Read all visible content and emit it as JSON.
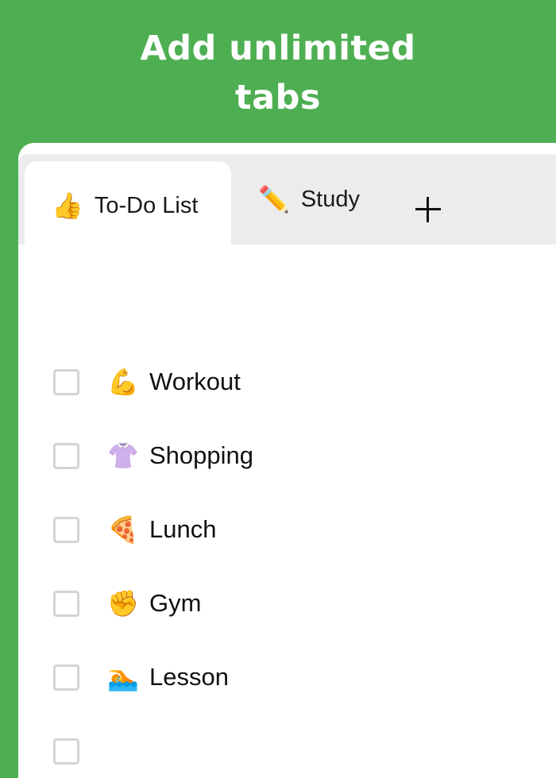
{
  "headline": {
    "line1": "Add unlimited",
    "line2": "tabs"
  },
  "tabs": [
    {
      "icon": "thumbs-up-icon",
      "emoji": "👍",
      "label": "To-Do List",
      "active": true
    },
    {
      "icon": "pencil-icon",
      "emoji": "✏️",
      "label": "Study",
      "active": false
    }
  ],
  "add_tab": {
    "icon": "plus-icon"
  },
  "items": [
    {
      "emoji": "💪",
      "icon": "flexed-biceps-icon",
      "label": "Workout",
      "checked": false
    },
    {
      "emoji": "👚",
      "icon": "blouse-icon",
      "label": "Shopping",
      "checked": false
    },
    {
      "emoji": "🍕",
      "icon": "pizza-icon",
      "label": "Lunch",
      "checked": false
    },
    {
      "emoji": "✊",
      "icon": "raised-fist-icon",
      "label": "Gym",
      "checked": false
    },
    {
      "emoji": "🏊",
      "icon": "swimmer-icon",
      "label": "Lesson",
      "checked": false
    }
  ],
  "colors": {
    "background": "#4eaf52",
    "tabbar": "#ececec",
    "checkbox_border": "#d4d4d4"
  }
}
